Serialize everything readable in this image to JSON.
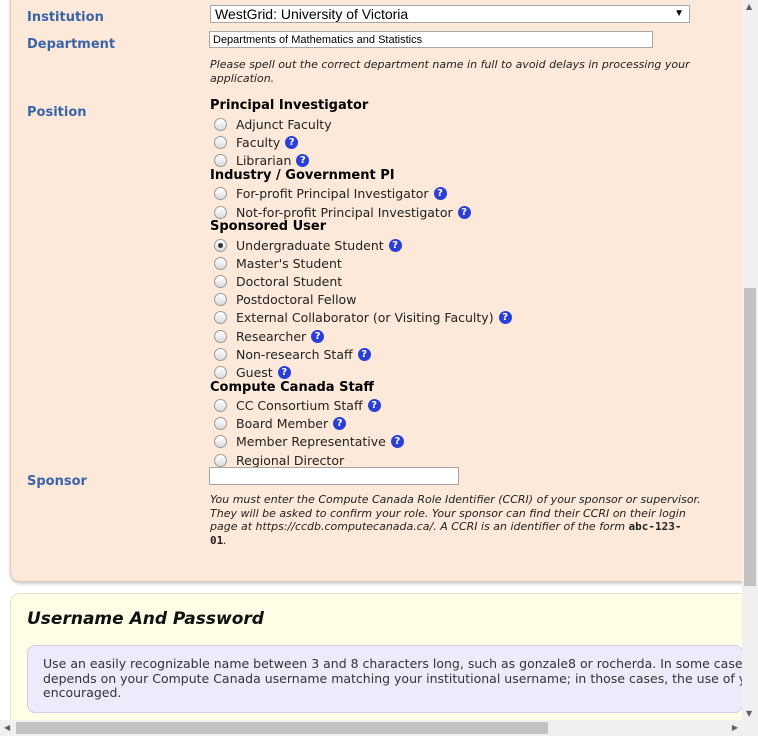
{
  "form": {
    "institution": {
      "label": "Institution",
      "value": "WestGrid: University of Victoria"
    },
    "department": {
      "label": "Department",
      "value": "Departments of Mathematics and Statistics",
      "note_line1": "Please spell out the correct department name in full to avoid delays in processing your",
      "note_line2": "application."
    },
    "position": {
      "label": "Position",
      "groups": [
        {
          "title": "Principal Investigator",
          "options": [
            {
              "label": "Adjunct Faculty",
              "help": false,
              "checked": false
            },
            {
              "label": "Faculty",
              "help": true,
              "checked": false
            },
            {
              "label": "Librarian",
              "help": true,
              "checked": false
            }
          ]
        },
        {
          "title": "Industry / Government PI",
          "options": [
            {
              "label": "For-profit Principal Investigator",
              "help": true,
              "checked": false
            },
            {
              "label": "Not-for-profit Principal Investigator",
              "help": true,
              "checked": false
            }
          ]
        },
        {
          "title": "Sponsored User",
          "options": [
            {
              "label": "Undergraduate Student",
              "help": true,
              "checked": true
            },
            {
              "label": "Master's Student",
              "help": false,
              "checked": false
            },
            {
              "label": "Doctoral Student",
              "help": false,
              "checked": false
            },
            {
              "label": "Postdoctoral Fellow",
              "help": false,
              "checked": false
            },
            {
              "label": "External Collaborator (or Visiting Faculty)",
              "help": true,
              "checked": false
            },
            {
              "label": "Researcher",
              "help": true,
              "checked": false
            },
            {
              "label": "Non-research Staff",
              "help": true,
              "checked": false
            },
            {
              "label": "Guest",
              "help": true,
              "checked": false
            }
          ]
        },
        {
          "title": "Compute Canada Staff",
          "options": [
            {
              "label": "CC Consortium Staff",
              "help": true,
              "checked": false
            },
            {
              "label": "Board Member",
              "help": true,
              "checked": false
            },
            {
              "label": "Member Representative",
              "help": true,
              "checked": false
            },
            {
              "label": "Regional Director",
              "help": false,
              "checked": false
            }
          ]
        }
      ]
    },
    "sponsor": {
      "label": "Sponsor",
      "value": "",
      "note_line1": "You must enter the Compute Canada Role Identifier (CCRI) of your sponsor or supervisor.",
      "note_line2": "They will be asked to confirm your role. Your sponsor can find their CCRI on their login",
      "note_line3": "page at https://ccdb.computecanada.ca/. A CCRI is an identifier of the form",
      "note_code_a": "abc-123-",
      "note_code_b": "01",
      "note_end": "."
    }
  },
  "help_glyph": "?",
  "username_section": {
    "title": "Username And Password",
    "info_line1": "Use an easily recognizable name between 3 and 8 characters long, such as gonzale8 or rocherda. In some cases, acc",
    "info_line2": "depends on your Compute Canada username matching your institutional username; in those cases, the use of your i",
    "info_line3": "encouraged."
  },
  "scrollbars": {
    "up_arrow": "▲",
    "down_arrow": "▼",
    "left_arrow": "◀",
    "right_arrow": "▶",
    "dropdown_arrow": "▼"
  }
}
